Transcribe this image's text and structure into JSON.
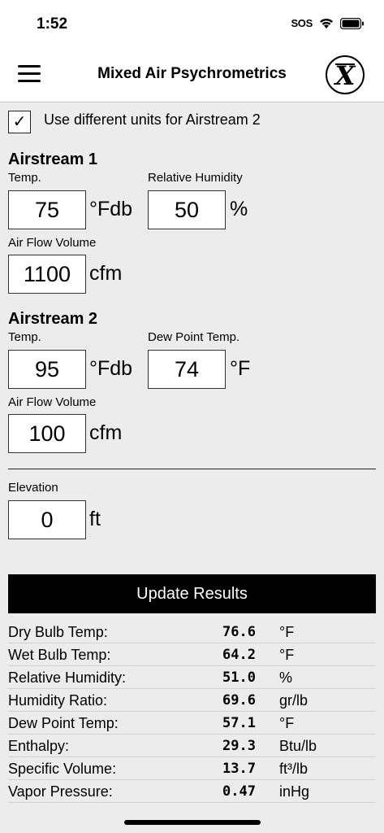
{
  "status_bar": {
    "time": "1:52",
    "sos": "SOS"
  },
  "nav": {
    "title": "Mixed Air Psychrometrics",
    "logo_glyph": "X"
  },
  "option": {
    "checked": true,
    "check_glyph": "✓",
    "label": "Use different units for Airstream 2"
  },
  "airstream1": {
    "title": "Airstream 1",
    "temp_label": "Temp.",
    "temp_value": "75",
    "temp_unit": "°Fdb",
    "rh_label": "Relative Humidity",
    "rh_value": "50",
    "rh_unit": "%",
    "flow_label": "Air Flow Volume",
    "flow_value": "1100",
    "flow_unit": "cfm"
  },
  "airstream2": {
    "title": "Airstream 2",
    "temp_label": "Temp.",
    "temp_value": "95",
    "temp_unit": "°Fdb",
    "dp_label": "Dew Point Temp.",
    "dp_value": "74",
    "dp_unit": "°F",
    "flow_label": "Air Flow Volume",
    "flow_value": "100",
    "flow_unit": "cfm"
  },
  "elevation": {
    "label": "Elevation",
    "value": "0",
    "unit": "ft"
  },
  "update_button": {
    "label": "Update Results"
  },
  "results": [
    {
      "label": "Dry Bulb Temp:",
      "value": "76.6",
      "unit": "°F"
    },
    {
      "label": "Wet Bulb Temp:",
      "value": "64.2",
      "unit": "°F"
    },
    {
      "label": "Relative Humidity:",
      "value": "51.0",
      "unit": "%"
    },
    {
      "label": "Humidity Ratio:",
      "value": "69.6",
      "unit": "gr/lb"
    },
    {
      "label": "Dew Point Temp:",
      "value": "57.1",
      "unit": "°F"
    },
    {
      "label": "Enthalpy:",
      "value": "29.3",
      "unit": "Btu/lb"
    },
    {
      "label": "Specific Volume:",
      "value": "13.7",
      "unit": "ft³/lb"
    },
    {
      "label": "Vapor Pressure:",
      "value": "0.47",
      "unit": "inHg"
    }
  ]
}
